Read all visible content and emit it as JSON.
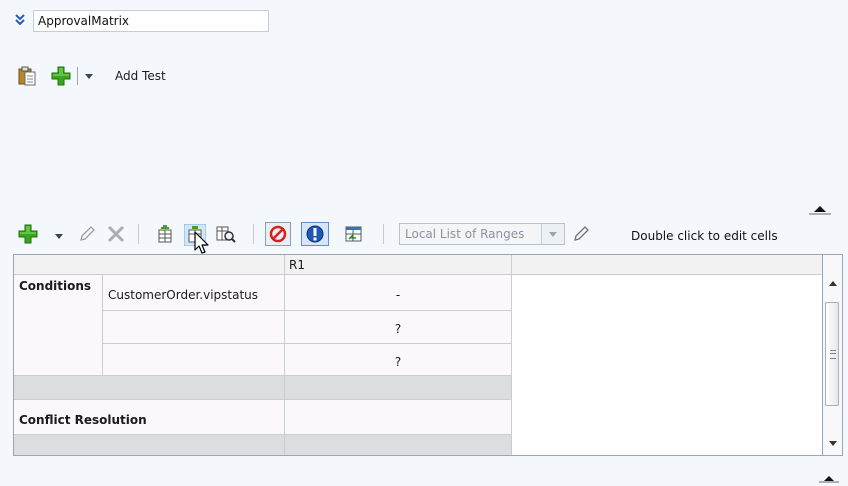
{
  "header": {
    "name_value": "ApprovalMatrix"
  },
  "test_toolbar": {
    "add_test_label": "Add Test"
  },
  "grid_toolbar": {
    "range_select_value": "Local List of Ranges",
    "hint": "Double click to edit cells"
  },
  "grid": {
    "column_header": "R1",
    "conditions_label": "Conditions",
    "conditions": [
      {
        "name": "CustomerOrder.vipstatus",
        "value": "-"
      },
      {
        "name": "",
        "value": "?"
      },
      {
        "name": "",
        "value": "?"
      }
    ],
    "conflict_label": "Conflict Resolution"
  },
  "colors": {
    "accent_green": "#3aa51f",
    "ban_red": "#d8201d",
    "alert_blue": "#1f58b9",
    "pink_cell": "#fcf7fb",
    "gray_row": "#dcdde0"
  }
}
